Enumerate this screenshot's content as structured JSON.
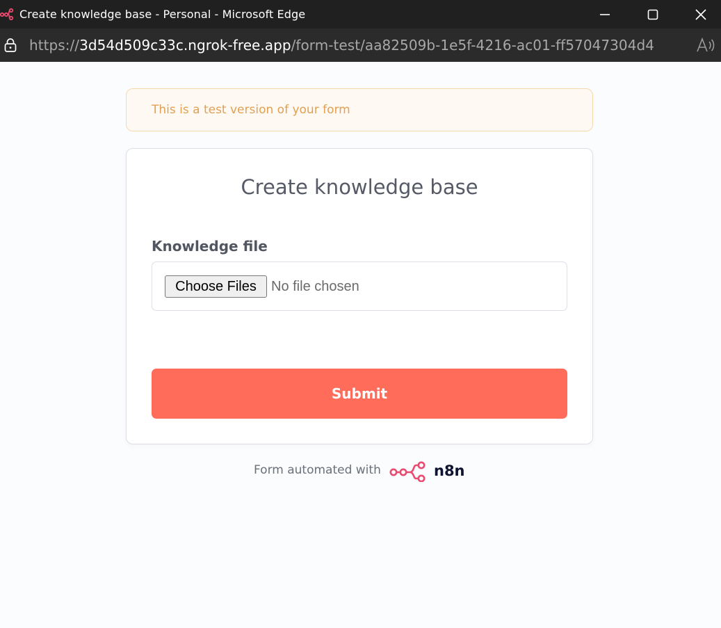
{
  "window": {
    "title": "Create knowledge base - Personal - Microsoft Edge"
  },
  "address_bar": {
    "scheme": "https://",
    "host": "3d54d509c33c.ngrok-free.app",
    "path": "/form-test/aa82509b-1e5f-4216-ac01-ff57047304d4"
  },
  "banner": {
    "text": "This is a test version of your form"
  },
  "form": {
    "title": "Create knowledge base",
    "field_label": "Knowledge file",
    "choose_button": "Choose Files",
    "file_status": "No file chosen",
    "submit_label": "Submit"
  },
  "footer": {
    "text": "Form automated with",
    "brand": "n8n"
  },
  "colors": {
    "accent": "#ff6d5a",
    "banner_text": "#e2a053",
    "logo_pink": "#ea4b71"
  },
  "icons": {
    "app": "n8n-logo-icon",
    "lock": "lock-icon",
    "read_aloud": "read-aloud-icon",
    "minimize": "minimize-icon",
    "maximize": "maximize-icon",
    "close": "close-icon",
    "footer_logo": "n8n-logo-icon"
  }
}
